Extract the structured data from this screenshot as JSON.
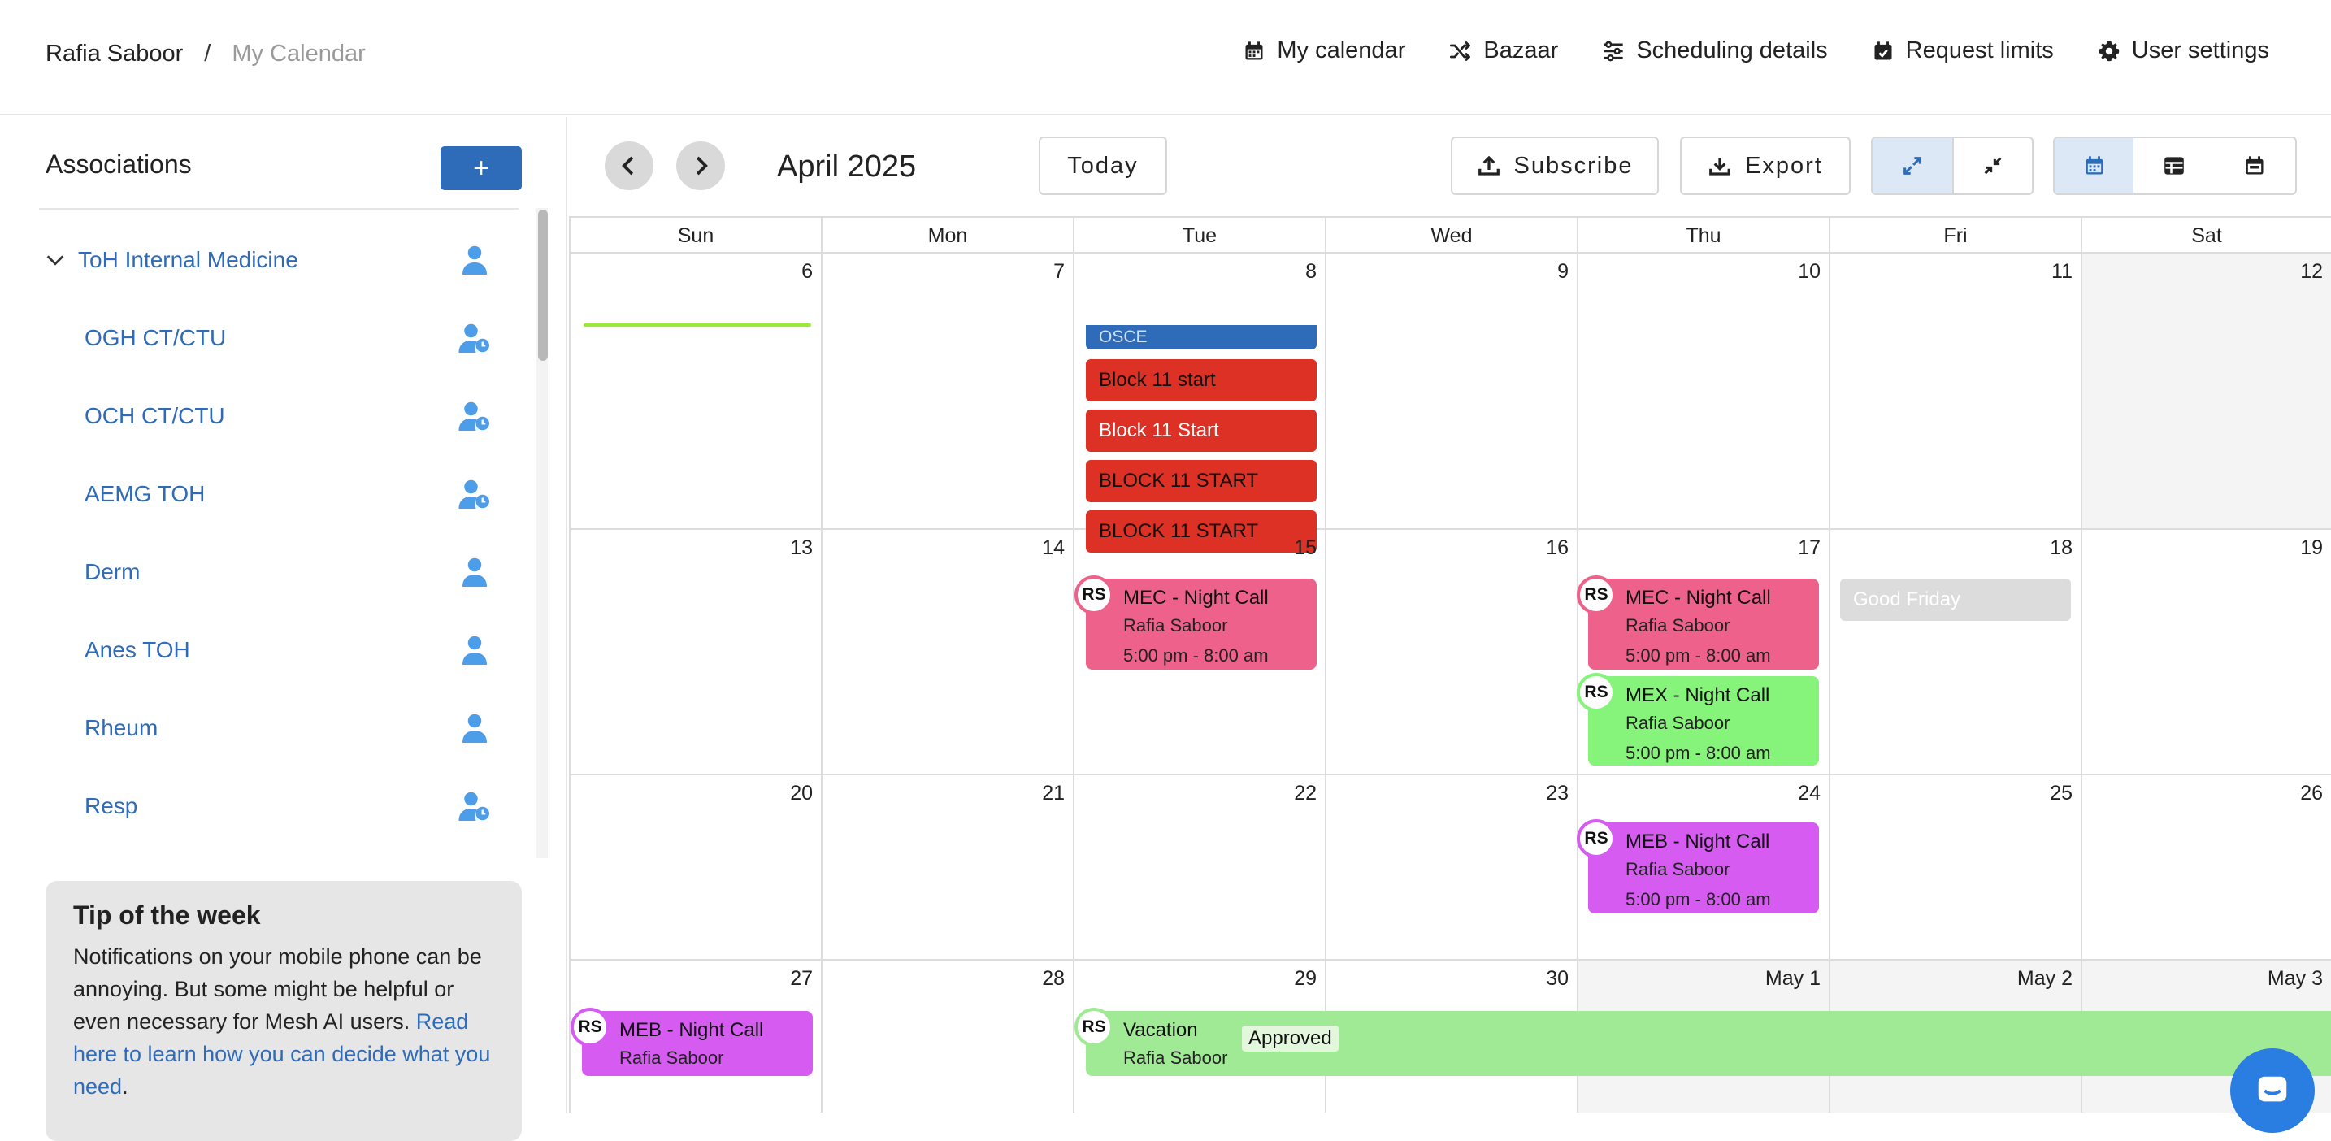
{
  "header": {
    "user_name": "Rafia Saboor",
    "separator": "/",
    "page_name": "My Calendar",
    "nav": [
      {
        "label": "My calendar",
        "icon": "calendar-icon"
      },
      {
        "label": "Bazaar",
        "icon": "shuffle-icon"
      },
      {
        "label": "Scheduling details",
        "icon": "sliders-icon"
      },
      {
        "label": "Request limits",
        "icon": "calendar-check-icon"
      },
      {
        "label": "User settings",
        "icon": "gear-icon"
      }
    ]
  },
  "sidebar": {
    "title": "Associations",
    "add_label": "+",
    "parent": {
      "label": "ToH Internal Medicine",
      "icon": "user-icon"
    },
    "items": [
      {
        "label": "OGH CT/CTU",
        "icon": "user-clock-icon"
      },
      {
        "label": "OCH CT/CTU",
        "icon": "user-clock-icon"
      },
      {
        "label": "AEMG TOH",
        "icon": "user-clock-icon"
      },
      {
        "label": "Derm",
        "icon": "user-icon"
      },
      {
        "label": "Anes TOH",
        "icon": "user-icon"
      },
      {
        "label": "Rheum",
        "icon": "user-icon"
      },
      {
        "label": "Resp",
        "icon": "user-clock-icon"
      }
    ],
    "tip": {
      "title": "Tip of the week",
      "body": "Notifications on your mobile phone can be annoying. But some might be helpful or even necessary for Mesh AI users.",
      "link": "Read here to learn how you can decide what you need",
      "tail": "."
    }
  },
  "toolbar": {
    "month": "April 2025",
    "today": "Today",
    "subscribe": "Subscribe",
    "export": "Export"
  },
  "calendar": {
    "days_of_week": [
      "Sun",
      "Mon",
      "Tue",
      "Wed",
      "Thu",
      "Fri",
      "Sat"
    ],
    "weeks": [
      [
        "6",
        "7",
        "8",
        "9",
        "10",
        "11",
        "12"
      ],
      [
        "13",
        "14",
        "15",
        "16",
        "17",
        "18",
        "19"
      ],
      [
        "20",
        "21",
        "22",
        "23",
        "24",
        "25",
        "26"
      ],
      [
        "27",
        "28",
        "29",
        "30",
        "May 1",
        "May 2",
        "May 3"
      ]
    ],
    "events": {
      "osce": "OSCE",
      "block1": "Block 11 start",
      "block2": "Block 11 Start",
      "block3": "BLOCK 11 START",
      "block4": "BLOCK 11 START",
      "good_friday": "Good Friday"
    },
    "shifts": [
      {
        "initials": "RS",
        "title": "MEC - Night Call",
        "person": "Rafia Saboor",
        "time": "5:00 pm - 8:00 am"
      },
      {
        "initials": "RS",
        "title": "MEC - Night Call",
        "person": "Rafia Saboor",
        "time": "5:00 pm - 8:00 am"
      },
      {
        "initials": "RS",
        "title": "MEX - Night Call",
        "person": "Rafia Saboor",
        "time": "5:00 pm - 8:00 am"
      },
      {
        "initials": "RS",
        "title": "MEB - Night Call",
        "person": "Rafia Saboor",
        "time": "5:00 pm - 8:00 am"
      },
      {
        "initials": "RS",
        "title": "MEB - Night Call",
        "person": "Rafia Saboor"
      },
      {
        "initials": "RS",
        "title": "Vacation",
        "person": "Rafia Saboor",
        "status": "Approved"
      }
    ]
  },
  "colors": {
    "accent": "#2e6bb8",
    "block_red": "#dc3124",
    "pink": "#ee618a",
    "green": "#86f47a",
    "purple": "#d55bf1",
    "light_green": "#a0ea96"
  }
}
